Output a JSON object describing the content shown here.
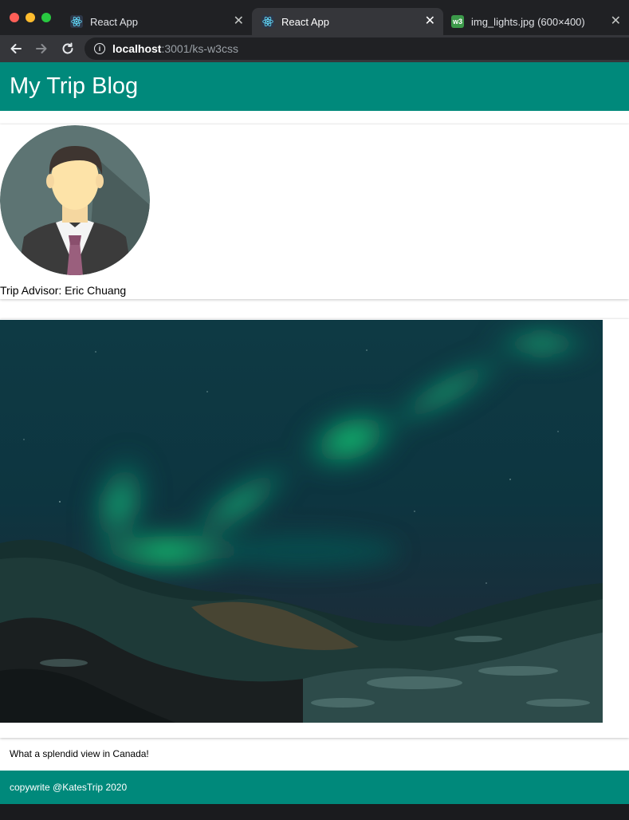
{
  "browser": {
    "tabs": [
      {
        "label": "React App",
        "favicon": "react-icon",
        "active": false
      },
      {
        "label": "React App",
        "favicon": "react-icon",
        "active": true
      },
      {
        "label": "img_lights.jpg (600×400)",
        "favicon": "w3-icon",
        "active": false
      }
    ],
    "close_glyph": "✕",
    "url_host": "localhost",
    "url_rest": ":3001/ks-w3css",
    "w3_favicon_text": "w3"
  },
  "page": {
    "site_title": "My Trip Blog",
    "advisor_text": "Trip Advisor: Eric Chuang",
    "caption": "What a splendid view in Canada!",
    "footer_text": "copywrite @KatesTrip 2020"
  },
  "colors": {
    "teal": "#00897b",
    "chrome_dark": "#202124",
    "chrome_toolbar": "#35363a"
  }
}
